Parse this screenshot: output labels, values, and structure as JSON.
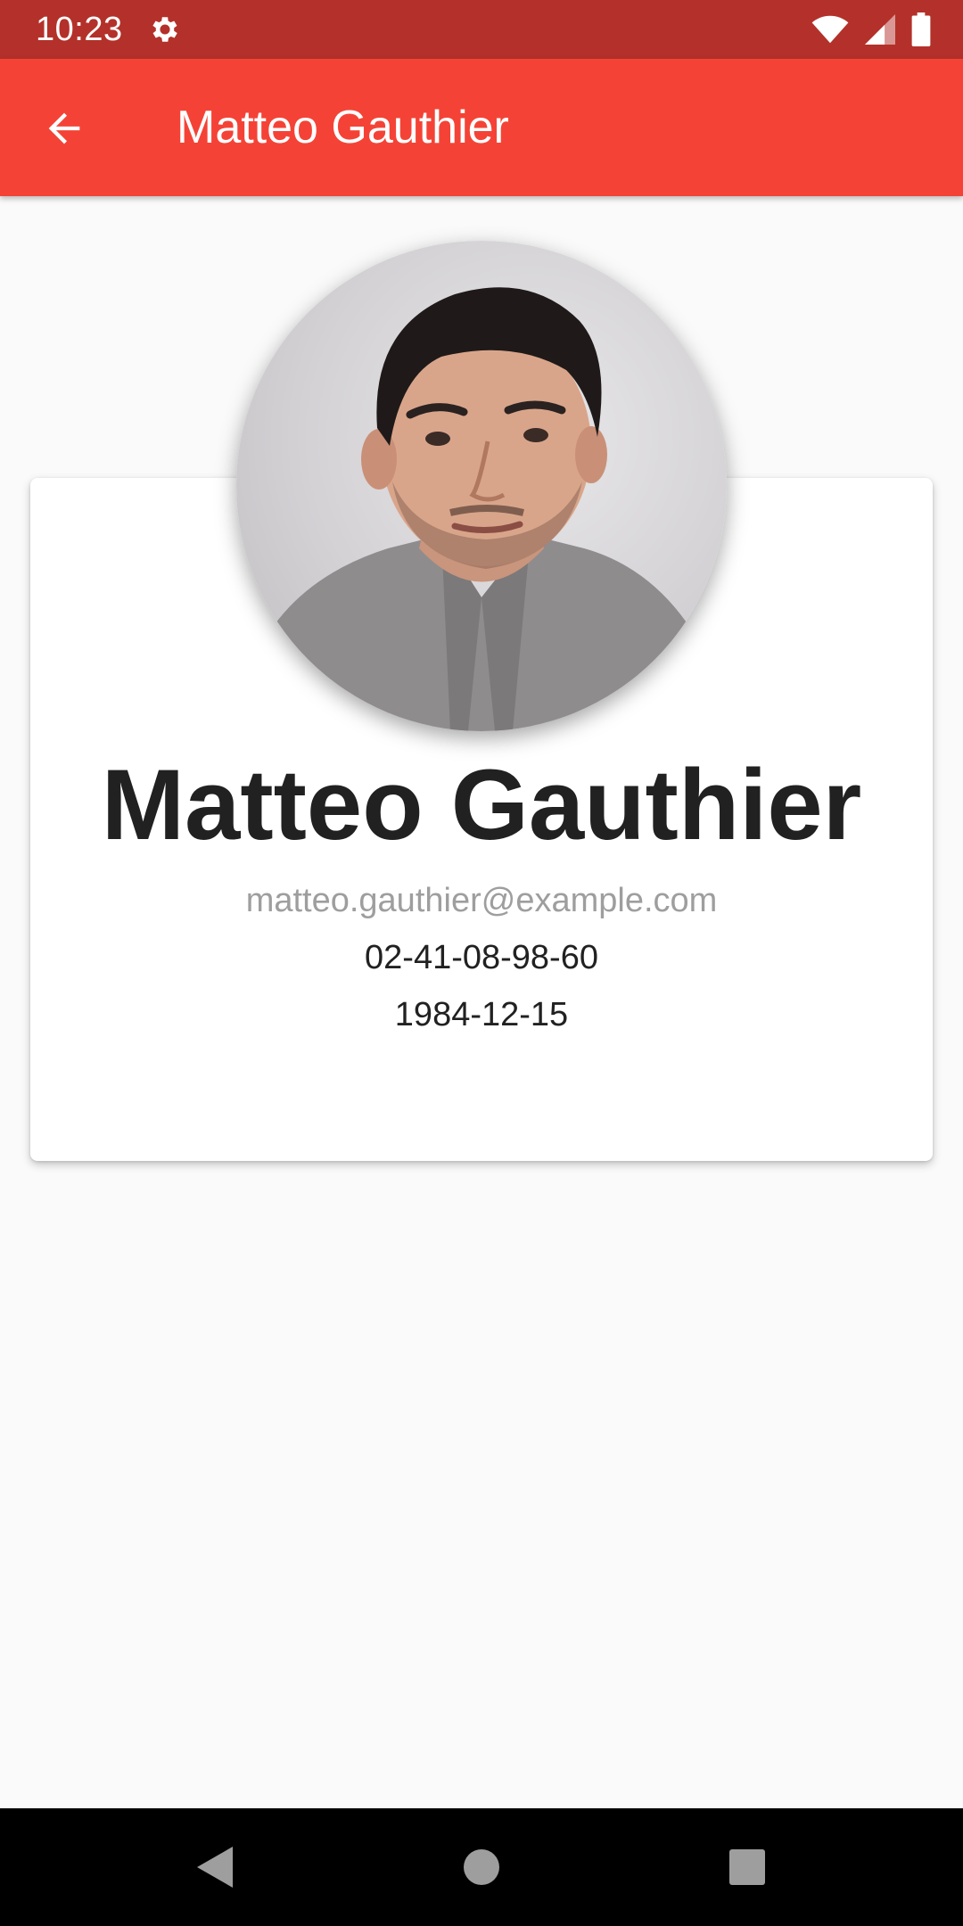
{
  "status_bar": {
    "time": "10:23",
    "icons": [
      "gear-icon",
      "wifi-icon",
      "signal-icon",
      "battery-icon"
    ],
    "color": "#b3312a"
  },
  "app_bar": {
    "title": "Matteo Gauthier",
    "back_icon": "arrow-back-icon",
    "color": "#f44336"
  },
  "profile": {
    "name": "Matteo Gauthier",
    "email": "matteo.gauthier@example.com",
    "phone": "02-41-08-98-60",
    "date_of_birth": "1984-12-15",
    "avatar": "profile-photo"
  },
  "nav_bar": {
    "buttons": [
      "back-triangle-icon",
      "home-circle-icon",
      "recents-square-icon"
    ]
  }
}
